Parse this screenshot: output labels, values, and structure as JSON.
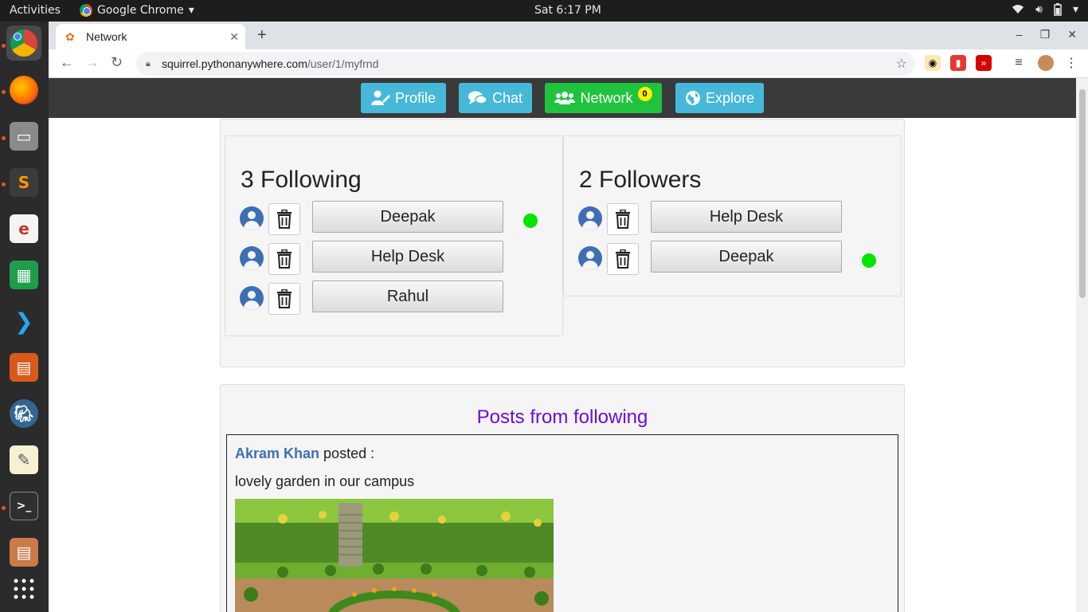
{
  "os": {
    "activities": "Activities",
    "app_menu": "Google Chrome",
    "clock": "Sat  6:17 PM"
  },
  "browser": {
    "tab_title": "Network",
    "url_host": "squirrel.pythonanywhere.com",
    "url_path": "/user/1/myfrnd"
  },
  "nav": {
    "profile": "Profile",
    "chat": "Chat",
    "network": "Network",
    "network_badge": "0",
    "explore": "Explore"
  },
  "following": {
    "title": "3 Following",
    "items": [
      {
        "name": "Deepak",
        "online": true
      },
      {
        "name": "Help Desk",
        "online": false
      },
      {
        "name": "Rahul",
        "online": false
      }
    ]
  },
  "followers": {
    "title": "2 Followers",
    "items": [
      {
        "name": "Help Desk",
        "online": false
      },
      {
        "name": "Deepak",
        "online": true
      }
    ]
  },
  "posts": {
    "title": "Posts from following",
    "items": [
      {
        "author": "Akram Khan",
        "suffix": "posted :",
        "text": "lovely garden in our campus"
      }
    ]
  },
  "colors": {
    "nav_blue": "#46b8da",
    "nav_green": "#1fc33d",
    "online": "#00e500",
    "posts_title": "#6a0dd6",
    "author": "#3d6fb5"
  }
}
